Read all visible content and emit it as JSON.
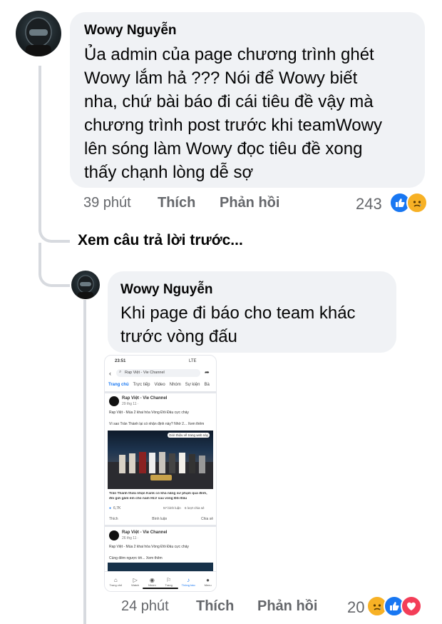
{
  "comment1": {
    "author": "Wowy Nguyễn",
    "lines": [
      "Ủa admin của page chương trình ghét",
      "Wowy lắm hả ??? Nói để Wowy biết",
      "nha, chứ bài báo đi cái tiêu đề vậy mà",
      "chương trình post trước khi teamWowy",
      "lên sóng làm Wowy đọc tiêu đề xong",
      "thấy chạnh lòng dễ sợ"
    ],
    "time": "39 phút",
    "like_label": "Thích",
    "reply_label": "Phản hồi",
    "reaction_count": "243",
    "reactions": [
      "like-icon",
      "sad-icon"
    ]
  },
  "view_previous": "Xem câu trả lời trước...",
  "reply": {
    "author": "Wowy Nguyễn",
    "lines": [
      "Khi page đi báo cho team khác",
      "trước vòng đấu"
    ],
    "time": "24 phút",
    "like_label": "Thích",
    "reply_label": "Phản hồi",
    "reaction_count": "20",
    "reactions": [
      "sad-icon",
      "like-icon",
      "love-icon"
    ]
  },
  "phone": {
    "status_time": "23:51",
    "status_right": "LTE",
    "search_text": "Rap Việt - Vie Channel",
    "tabs": [
      "Trang chủ",
      "Trực tiếp",
      "Video",
      "Nhóm",
      "Sự kiện",
      "Bà"
    ],
    "post1": {
      "page": "Rap Việt - Vie Channel",
      "date": "29 thg 11 ·",
      "text1": "Rap Việt - Mùa 2 khai hỏa Vòng Đối Đầu cực cháy",
      "text2": "Vì sao Trấn Thành lại có nhận định này? Nhờ 2... Xem thêm",
      "badge": "Giới thiệu về trang web này",
      "caption1": "Trấn Thành thừa nhận Karik có khả năng sư phạm quá đỉnh,",
      "caption2": "đôi gửi gắm em cho nam HLV sau vòng Đối Đầu",
      "likes": "6,7K",
      "comments": "57 bình luận",
      "shares": "6 lượt chia sẻ",
      "action_like": "Thích",
      "action_comment": "Bình luận",
      "action_share": "Chia sẻ"
    },
    "post2": {
      "page": "Rap Việt - Vie Channel",
      "date": "26 thg 11 ·",
      "text1": "Rap Việt - Mùa 2 khai hỏa Vòng Đối Đầu cực cháy",
      "text2": "Cùng đếm ngược tới... Xem thêm"
    },
    "nav": [
      "Trang chủ",
      "Watch",
      "Nhóm",
      "Trang",
      "Thông báo",
      "Menu"
    ]
  },
  "colors": {
    "bubble": "#f0f2f5",
    "meta_text": "#65676b",
    "like_blue": "#1877f2",
    "love_red": "#f33e58",
    "sad_yellow": "#f7b125"
  }
}
